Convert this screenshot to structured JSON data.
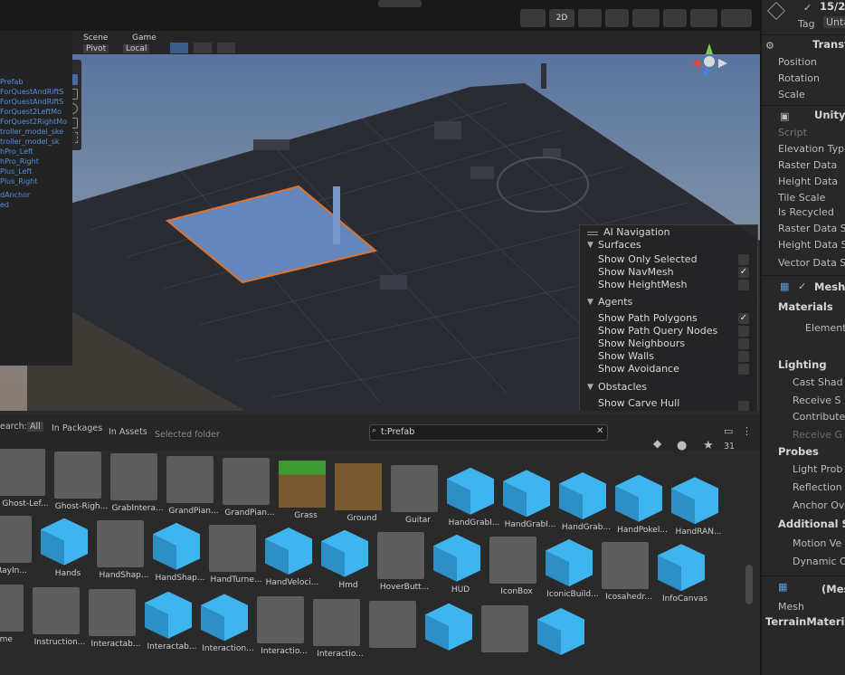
{
  "toolbar": {
    "mode_2d": "2D"
  },
  "scene_tabs": {
    "scene": "Scene",
    "game": "Game",
    "pivot": "Pivot",
    "local": "Local"
  },
  "hierarchy": {
    "items": [
      "Prefab",
      "ForQuestAndRiftS",
      "ForQuestAndRiftS",
      "ForQuest2LeftMo",
      "ForQuest2RightMo",
      "troller_model_ske",
      "troller_model_sk",
      "hPro_Left",
      "hPro_Right",
      "Plus_Left",
      "Plus_Right",
      "dAnchor",
      "ed"
    ]
  },
  "ai_navigation": {
    "title": "AI Navigation",
    "surfaces": {
      "label": "Surfaces",
      "rows": [
        {
          "label": "Show Only Selected",
          "checked": false
        },
        {
          "label": "Show NavMesh",
          "checked": true
        },
        {
          "label": "Show HeightMesh",
          "checked": false
        }
      ]
    },
    "agents": {
      "label": "Agents",
      "rows": [
        {
          "label": "Show Path Polygons",
          "checked": true
        },
        {
          "label": "Show Path Query Nodes",
          "checked": false
        },
        {
          "label": "Show Neighbours",
          "checked": false
        },
        {
          "label": "Show Walls",
          "checked": false
        },
        {
          "label": "Show Avoidance",
          "checked": false
        }
      ]
    },
    "obstacles": {
      "label": "Obstacles",
      "rows": [
        {
          "label": "Show Carve Hull",
          "checked": false
        }
      ]
    }
  },
  "project": {
    "search_label": "earch:",
    "filter_all": "All",
    "filter_packages": "In Packages",
    "filter_assets": "In Assets",
    "filter_folder": "Selected folder",
    "search_value": "t:Prefab",
    "count": "31",
    "assets_row1": [
      {
        "label": "Ghost-Lef...",
        "type": "grey"
      },
      {
        "label": "Ghost-Righ...",
        "type": "grey"
      },
      {
        "label": "GrabIntera...",
        "type": "grey"
      },
      {
        "label": "GrandPian...",
        "type": "grey"
      },
      {
        "label": "GrandPian...",
        "type": "grey"
      },
      {
        "label": "Grass",
        "type": "grass"
      },
      {
        "label": "Ground",
        "type": "dirt"
      },
      {
        "label": "Guitar",
        "type": "grey"
      },
      {
        "label": "HandGrabI...",
        "type": "cube"
      },
      {
        "label": "HandGrabI...",
        "type": "cube"
      },
      {
        "label": "HandGrab...",
        "type": "cube"
      },
      {
        "label": "HandPokel...",
        "type": "cube"
      },
      {
        "label": "HandRAN...",
        "type": "cube"
      }
    ],
    "assets_row2": [
      {
        "label": "RayIn...",
        "type": "grey"
      },
      {
        "label": "Hands",
        "type": "cube"
      },
      {
        "label": "HandShap...",
        "type": "grey"
      },
      {
        "label": "HandShap...",
        "type": "cube"
      },
      {
        "label": "HandTurne...",
        "type": "grey"
      },
      {
        "label": "HandVeloci...",
        "type": "cube"
      },
      {
        "label": "Hmd",
        "type": "cube"
      },
      {
        "label": "HoverButt...",
        "type": "grey"
      },
      {
        "label": "HUD",
        "type": "cube"
      },
      {
        "label": "IconBox",
        "type": "grey"
      },
      {
        "label": "IconicBuild...",
        "type": "cube"
      },
      {
        "label": "Icosahedr...",
        "type": "grey"
      },
      {
        "label": "InfoCanvas",
        "type": "cube"
      }
    ],
    "assets_row3": [
      {
        "label": "ame",
        "type": "grey"
      },
      {
        "label": "Instruction...",
        "type": "grey"
      },
      {
        "label": "Interactab...",
        "type": "grey"
      },
      {
        "label": "Interactab...",
        "type": "cube"
      },
      {
        "label": "Interaction...",
        "type": "cube"
      },
      {
        "label": "Interactio...",
        "type": "grey"
      },
      {
        "label": "Interactio...",
        "type": "grey"
      },
      {
        "label": "",
        "type": "grey"
      },
      {
        "label": "",
        "type": "cube"
      },
      {
        "label": "",
        "type": "grey"
      },
      {
        "label": "",
        "type": "cube"
      }
    ]
  },
  "inspector": {
    "count": "15/2",
    "tag_label": "Tag",
    "tag_value": "Unta",
    "transform": "Transf",
    "position": "Position",
    "rotation": "Rotation",
    "scale": "Scale",
    "unity_component": "Unity T",
    "script": "Script",
    "elevation": "Elevation Typ",
    "raster_data": "Raster Data",
    "height_data": "Height Data",
    "tile_scale": "Tile Scale",
    "is_recycled": "Is Recycled",
    "raster_data_s": "Raster Data S",
    "height_data_s": "Height Data S",
    "vector_data_s": "Vector Data S",
    "mesh_component": "Mesh",
    "materials": "Materials",
    "element": "Element",
    "lighting": "Lighting",
    "cast_shadows": "Cast Shad",
    "receive_s": "Receive S",
    "contribute": "Contribute",
    "receive_g": "Receive G",
    "probes": "Probes",
    "light_probes": "Light Prob",
    "reflection": "Reflection",
    "anchor_ov": "Anchor Ov",
    "additional_s": "Additional S",
    "motion_v": "Motion Ve",
    "dynamic_o": "Dynamic O",
    "mesh_header": "(Mes",
    "mesh_label": "Mesh",
    "terrain_material": "TerrainMateria"
  }
}
